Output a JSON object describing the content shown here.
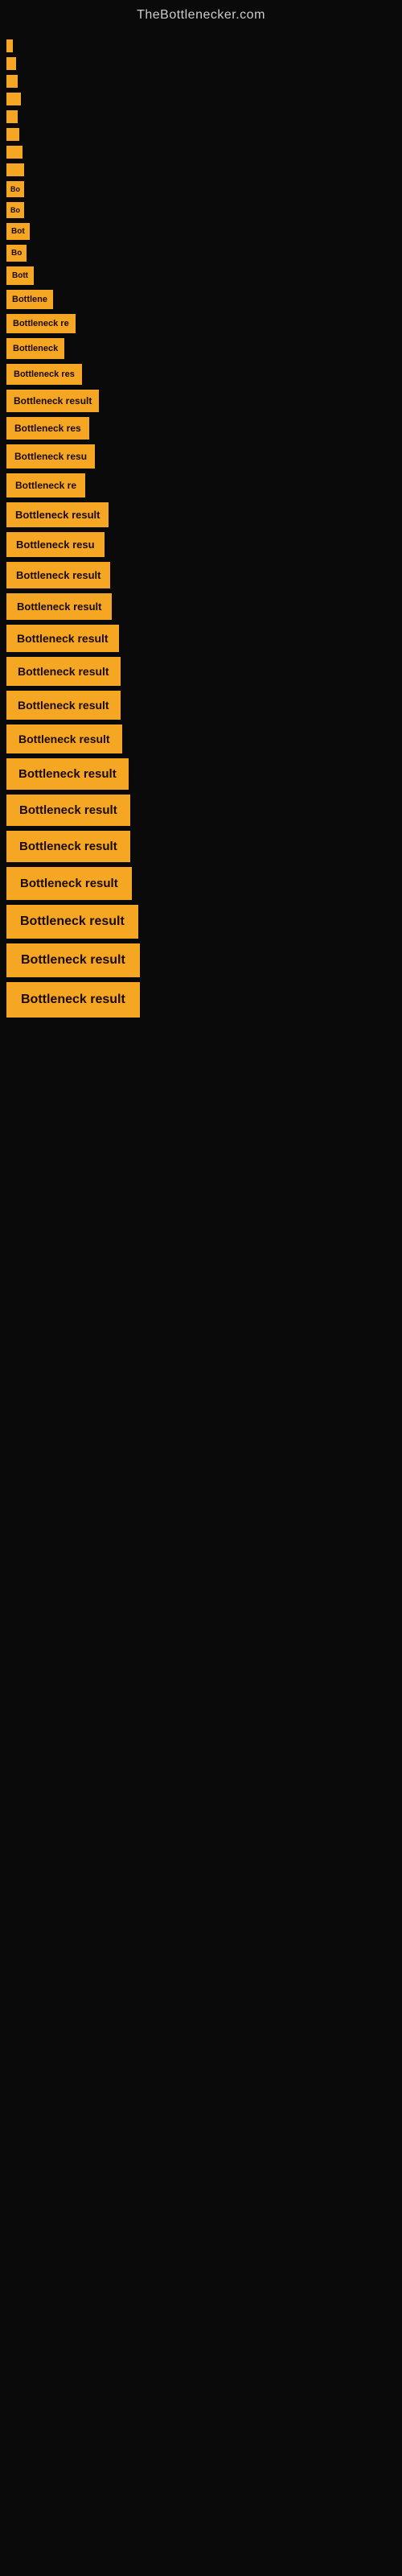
{
  "header": {
    "title": "TheBottlenecker.com"
  },
  "items": [
    {
      "id": 1,
      "label": ""
    },
    {
      "id": 2,
      "label": ""
    },
    {
      "id": 3,
      "label": ""
    },
    {
      "id": 4,
      "label": ""
    },
    {
      "id": 5,
      "label": ""
    },
    {
      "id": 6,
      "label": ""
    },
    {
      "id": 7,
      "label": ""
    },
    {
      "id": 8,
      "label": ""
    },
    {
      "id": 9,
      "label": "Bo"
    },
    {
      "id": 10,
      "label": "Bo"
    },
    {
      "id": 11,
      "label": "Bot"
    },
    {
      "id": 12,
      "label": "Bo"
    },
    {
      "id": 13,
      "label": "Bott"
    },
    {
      "id": 14,
      "label": "Bottlene"
    },
    {
      "id": 15,
      "label": "Bottleneck re"
    },
    {
      "id": 16,
      "label": "Bottleneck"
    },
    {
      "id": 17,
      "label": "Bottleneck res"
    },
    {
      "id": 18,
      "label": "Bottleneck result"
    },
    {
      "id": 19,
      "label": "Bottleneck res"
    },
    {
      "id": 20,
      "label": "Bottleneck resu"
    },
    {
      "id": 21,
      "label": "Bottleneck re"
    },
    {
      "id": 22,
      "label": "Bottleneck result"
    },
    {
      "id": 23,
      "label": "Bottleneck resu"
    },
    {
      "id": 24,
      "label": "Bottleneck result"
    },
    {
      "id": 25,
      "label": "Bottleneck result"
    },
    {
      "id": 26,
      "label": "Bottleneck result"
    },
    {
      "id": 27,
      "label": "Bottleneck result"
    },
    {
      "id": 28,
      "label": "Bottleneck result"
    },
    {
      "id": 29,
      "label": "Bottleneck result"
    },
    {
      "id": 30,
      "label": "Bottleneck result"
    },
    {
      "id": 31,
      "label": "Bottleneck result"
    },
    {
      "id": 32,
      "label": "Bottleneck result"
    },
    {
      "id": 33,
      "label": "Bottleneck result"
    },
    {
      "id": 34,
      "label": "Bottleneck result"
    },
    {
      "id": 35,
      "label": "Bottleneck result"
    },
    {
      "id": 36,
      "label": "Bottleneck result"
    }
  ]
}
